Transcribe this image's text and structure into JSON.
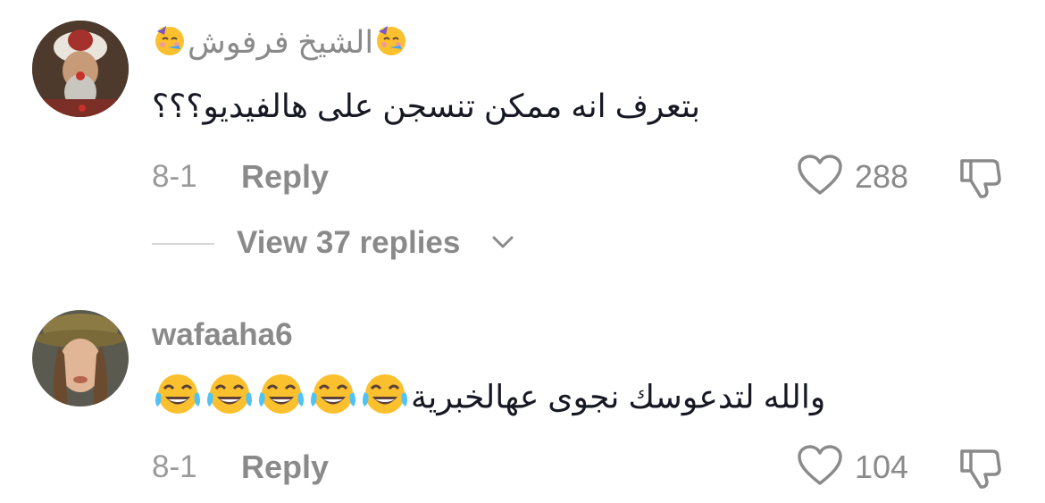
{
  "comments": [
    {
      "username": "الشيخ  فرفوش",
      "text": "بتعرف انه ممكن تنسجن على هالفيديو؟؟؟",
      "date": "8-1",
      "reply_label": "Reply",
      "likes": "288",
      "view_replies_label": "View 37 replies",
      "username_emoji": "partying-face-emoji"
    },
    {
      "username": "wafaaha6",
      "text": "والله لتدعوسك نجوى عهالخبرية",
      "date": "8-1",
      "reply_label": "Reply",
      "likes": "104",
      "trailing_emoji": "face-with-tears-of-joy-emoji",
      "trailing_emoji_count": 5
    }
  ],
  "icons": {
    "like": "heart-outline-icon",
    "dislike": "thumbs-down-outline-icon",
    "expand": "chevron-down-icon"
  },
  "colors": {
    "text_primary": "#161823",
    "text_secondary": "#8a8a8a",
    "background": "#ffffff"
  }
}
